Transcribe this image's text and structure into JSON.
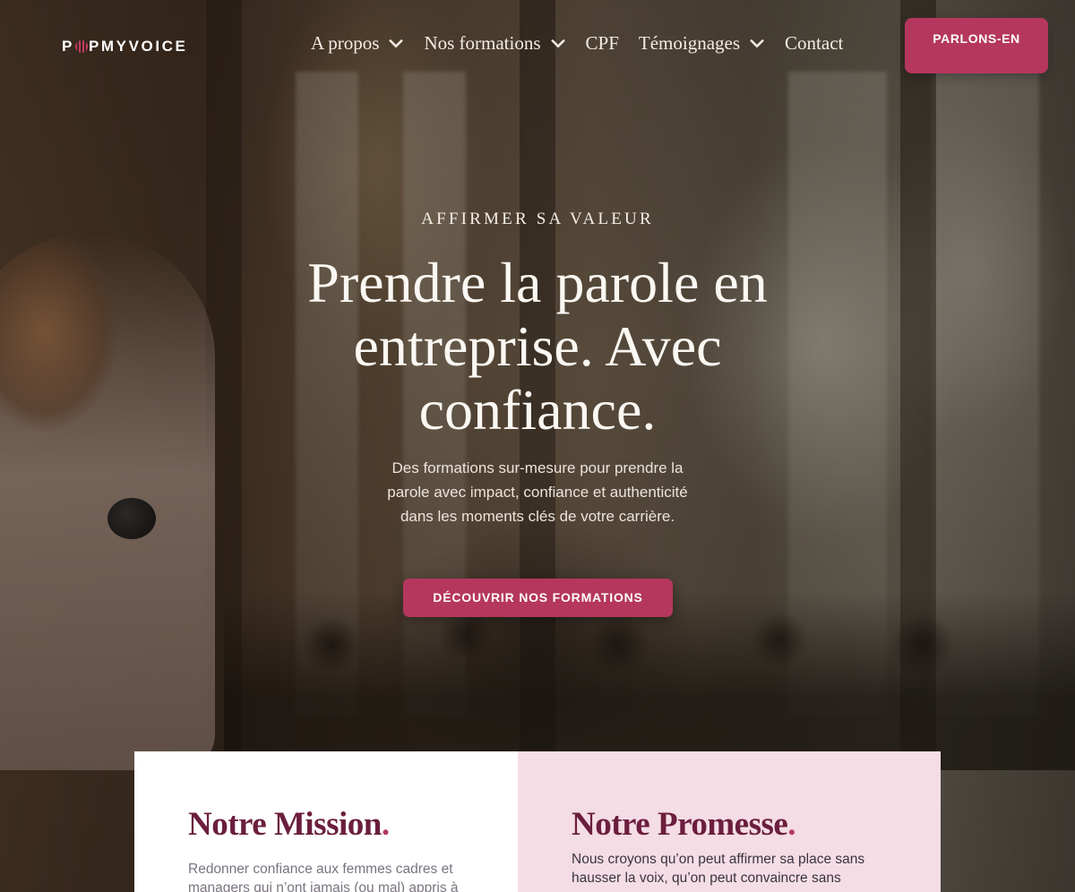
{
  "brand": {
    "logo_text_pre": "P",
    "logo_text_post": "PMYVOICE",
    "accent": "#b5375e",
    "mark_icon": "sound-wave-icon"
  },
  "nav": {
    "items": [
      {
        "label": "A propos",
        "has_dropdown": true
      },
      {
        "label": "Nos formations",
        "has_dropdown": true
      },
      {
        "label": "CPF",
        "has_dropdown": false
      },
      {
        "label": "Témoignages",
        "has_dropdown": true
      },
      {
        "label": "Contact",
        "has_dropdown": false
      }
    ],
    "cta_label": "PARLONS-EN"
  },
  "hero": {
    "eyebrow": "AFFIRMER SA VALEUR",
    "headline": "Prendre la parole en entreprise. Avec confiance.",
    "lead": "Des formations sur-mesure pour prendre la parole avec impact, confiance et authenticité dans les moments clés de votre carrière.",
    "cta_label": "DÉCOUVRIR NOS FORMATIONS"
  },
  "cards": {
    "mission": {
      "title": "Notre Mission",
      "body": "Redonner confiance aux femmes cadres et managers qui n’ont jamais (ou mal) appris à"
    },
    "promise": {
      "title": "Notre Promesse",
      "body": "Nous croyons qu’on peut affirmer sa place sans hausser la voix, qu’on peut convaincre sans"
    }
  }
}
